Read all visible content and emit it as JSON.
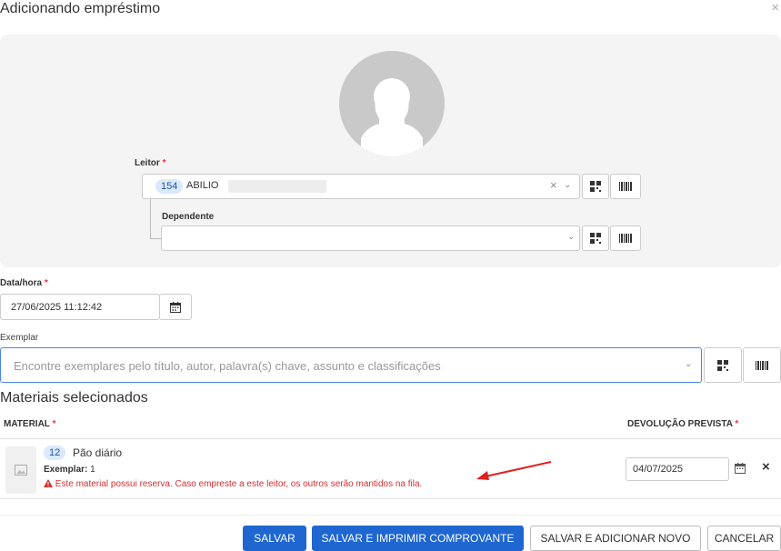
{
  "modal": {
    "title": "Adicionando empréstimo",
    "close_icon": "×"
  },
  "reader": {
    "label": "Leitor",
    "required_mark": "*",
    "selected_id": "154",
    "selected_name": "ABILIO",
    "clear_icon": "×",
    "dependent_label": "Dependente",
    "dependent_value": ""
  },
  "datetime": {
    "label": "Data/hora",
    "required_mark": "*",
    "value": "27/06/2025 11:12:42"
  },
  "exemplar": {
    "label": "Exemplar",
    "placeholder": "Encontre exemplares pelo título, autor, palavra(s) chave, assunto e classificações"
  },
  "materials": {
    "section_title": "Materiais selecionados",
    "col_material": "MATERIAL",
    "col_return": "DEVOLUÇÃO PREVISTA",
    "required_mark": "*",
    "rows": [
      {
        "id": "12",
        "title": "Pão diário",
        "exemplar_label": "Exemplar:",
        "exemplar_value": "1",
        "warning": "Este material possui reserva. Caso empreste a este leitor, os outros serão mantidos na fila.",
        "return_date": "04/07/2025",
        "remove_icon": "×"
      }
    ]
  },
  "footer": {
    "save": "SALVAR",
    "save_print": "SALVAR E IMPRIMIR COMPROVANTE",
    "save_new": "SALVAR E ADICIONAR NOVO",
    "cancel": "CANCELAR"
  },
  "colors": {
    "primary": "#1f66d1",
    "warning": "#d32f2f",
    "badge_bg": "#dce9fb",
    "annotation_arrow": "#e02020"
  }
}
